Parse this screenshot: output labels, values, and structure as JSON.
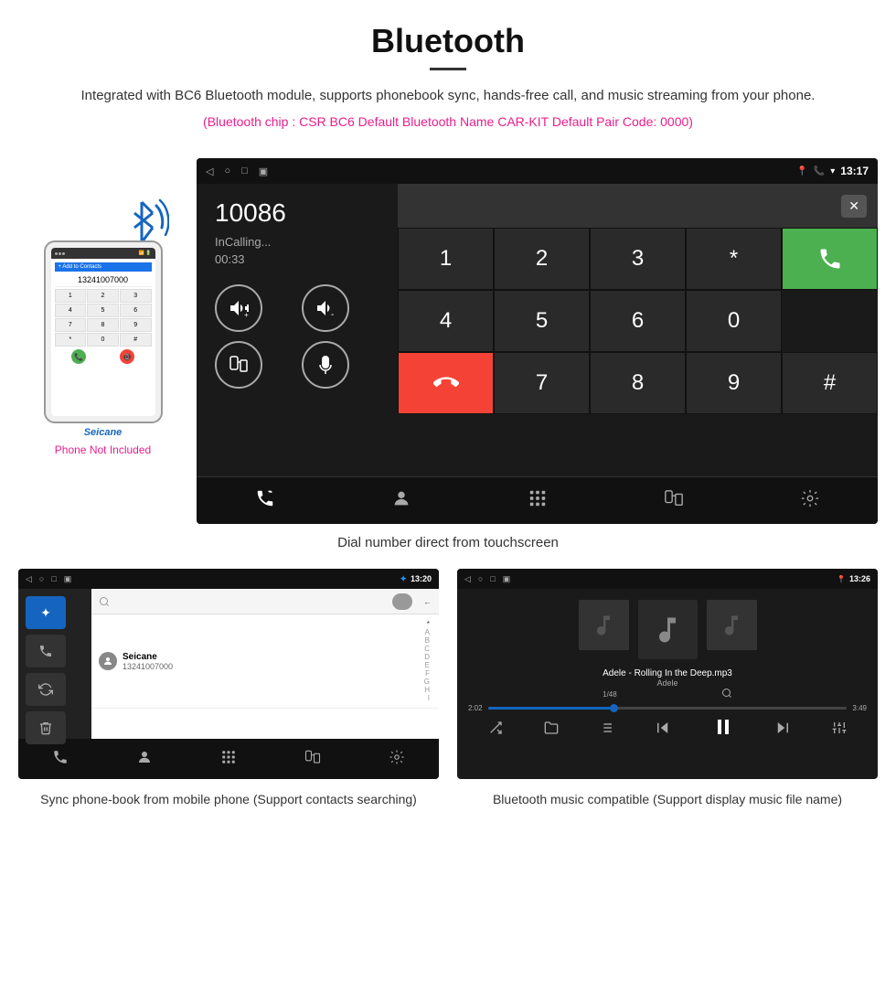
{
  "header": {
    "title": "Bluetooth",
    "description": "Integrated with BC6 Bluetooth module, supports phonebook sync, hands-free call, and music streaming from your phone.",
    "specs": "(Bluetooth chip : CSR BC6    Default Bluetooth Name CAR-KIT    Default Pair Code: 0000)"
  },
  "dialer_screen": {
    "status_bar": {
      "nav_back": "◁",
      "nav_home": "○",
      "nav_recent": "□",
      "nav_more": "▣",
      "location_icon": "📍",
      "phone_icon": "📞",
      "wifi_icon": "▾",
      "time": "13:17"
    },
    "caller": {
      "number": "10086",
      "status": "InCalling...",
      "duration": "00:33"
    },
    "controls": {
      "vol_up": "+",
      "vol_down": "-",
      "transfer": "⊡",
      "mute": "🎤"
    },
    "keypad": {
      "keys": [
        "1",
        "2",
        "3",
        "*",
        "4",
        "5",
        "6",
        "0",
        "7",
        "8",
        "9",
        "#"
      ],
      "call_btn": "📞",
      "end_btn": "📵"
    },
    "bottom_icons": [
      "📞↕",
      "👤",
      "⊞",
      "📋↕",
      "⚙"
    ]
  },
  "caption_main": "Dial number direct from touchscreen",
  "phonebook_screen": {
    "status_bar": {
      "time": "13:20",
      "bt_icon": "*"
    },
    "contact": {
      "name": "Seicane",
      "number": "13241007000"
    },
    "alpha_list": [
      "*",
      "A",
      "B",
      "C",
      "D",
      "E",
      "F",
      "G",
      "H",
      "I"
    ]
  },
  "music_screen": {
    "status_bar": {
      "time": "13:26"
    },
    "track": {
      "title": "Adele - Rolling In the Deep.mp3",
      "artist": "Adele",
      "position": "1/48"
    },
    "progress": {
      "current": "2:02",
      "total": "3:49",
      "percent": 35
    }
  },
  "captions": {
    "phonebook": "Sync phone-book from mobile phone\n(Support contacts searching)",
    "music": "Bluetooth music compatible\n(Support display music file name)"
  },
  "phone_not_included": "Phone Not Included",
  "seicane_logo": "Seicane"
}
